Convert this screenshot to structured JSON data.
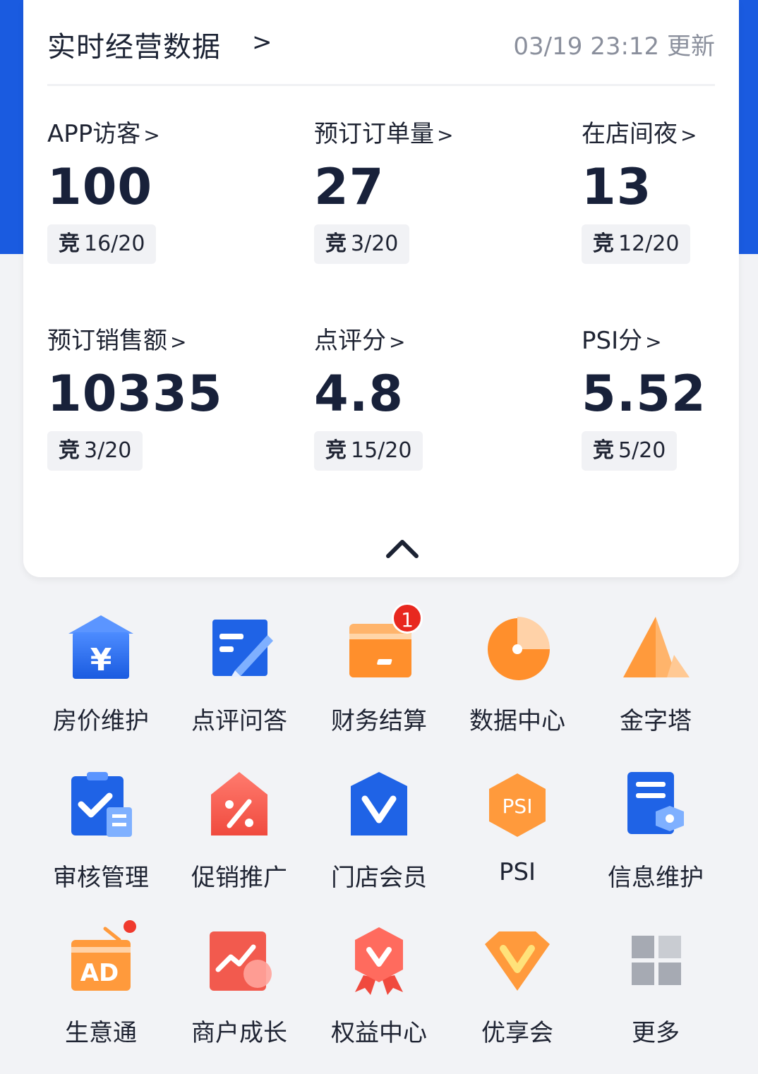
{
  "header": {
    "title": "实时经营数据",
    "title_arrow": ">",
    "update_time": "03/19 23:12 更新"
  },
  "metrics": [
    {
      "label": "APP访客",
      "value": "100",
      "badge_prefix": "竞",
      "badge_rank": "16/20"
    },
    {
      "label": "预订订单量",
      "value": "27",
      "badge_prefix": "竞",
      "badge_rank": "3/20"
    },
    {
      "label": "在店间夜",
      "value": "13",
      "badge_prefix": "竞",
      "badge_rank": "12/20"
    },
    {
      "label": "预订销售额",
      "value": "10335",
      "badge_prefix": "竞",
      "badge_rank": "3/20"
    },
    {
      "label": "点评分",
      "value": "4.8",
      "badge_prefix": "竞",
      "badge_rank": "15/20"
    },
    {
      "label": "PSI分",
      "value": "5.52",
      "badge_prefix": "竞",
      "badge_rank": "5/20"
    }
  ],
  "metric_chevron": ">",
  "grid": [
    {
      "label": "房价维护",
      "icon": "house-yen-icon"
    },
    {
      "label": "点评问答",
      "icon": "review-edit-icon"
    },
    {
      "label": "财务结算",
      "icon": "wallet-icon",
      "badge": "1"
    },
    {
      "label": "数据中心",
      "icon": "pie-chart-icon"
    },
    {
      "label": "金字塔",
      "icon": "pyramid-icon"
    },
    {
      "label": "审核管理",
      "icon": "clipboard-check-icon"
    },
    {
      "label": "促销推广",
      "icon": "discount-tag-icon"
    },
    {
      "label": "门店会员",
      "icon": "member-shield-icon"
    },
    {
      "label": "PSI",
      "icon": "psi-hexagon-icon",
      "icon_text": "PSI"
    },
    {
      "label": "信息维护",
      "icon": "info-settings-icon"
    },
    {
      "label": "生意通",
      "icon": "ad-radio-icon",
      "icon_text": "AD"
    },
    {
      "label": "商户成长",
      "icon": "growth-chart-icon"
    },
    {
      "label": "权益中心",
      "icon": "rights-medal-icon"
    },
    {
      "label": "优享会",
      "icon": "vip-diamond-icon"
    },
    {
      "label": "更多",
      "icon": "more-grid-icon"
    }
  ],
  "colors": {
    "brand_blue": "#1a5be0",
    "orange": "#ff8a2a",
    "red": "#f04a3e",
    "gray": "#a6aab3"
  }
}
